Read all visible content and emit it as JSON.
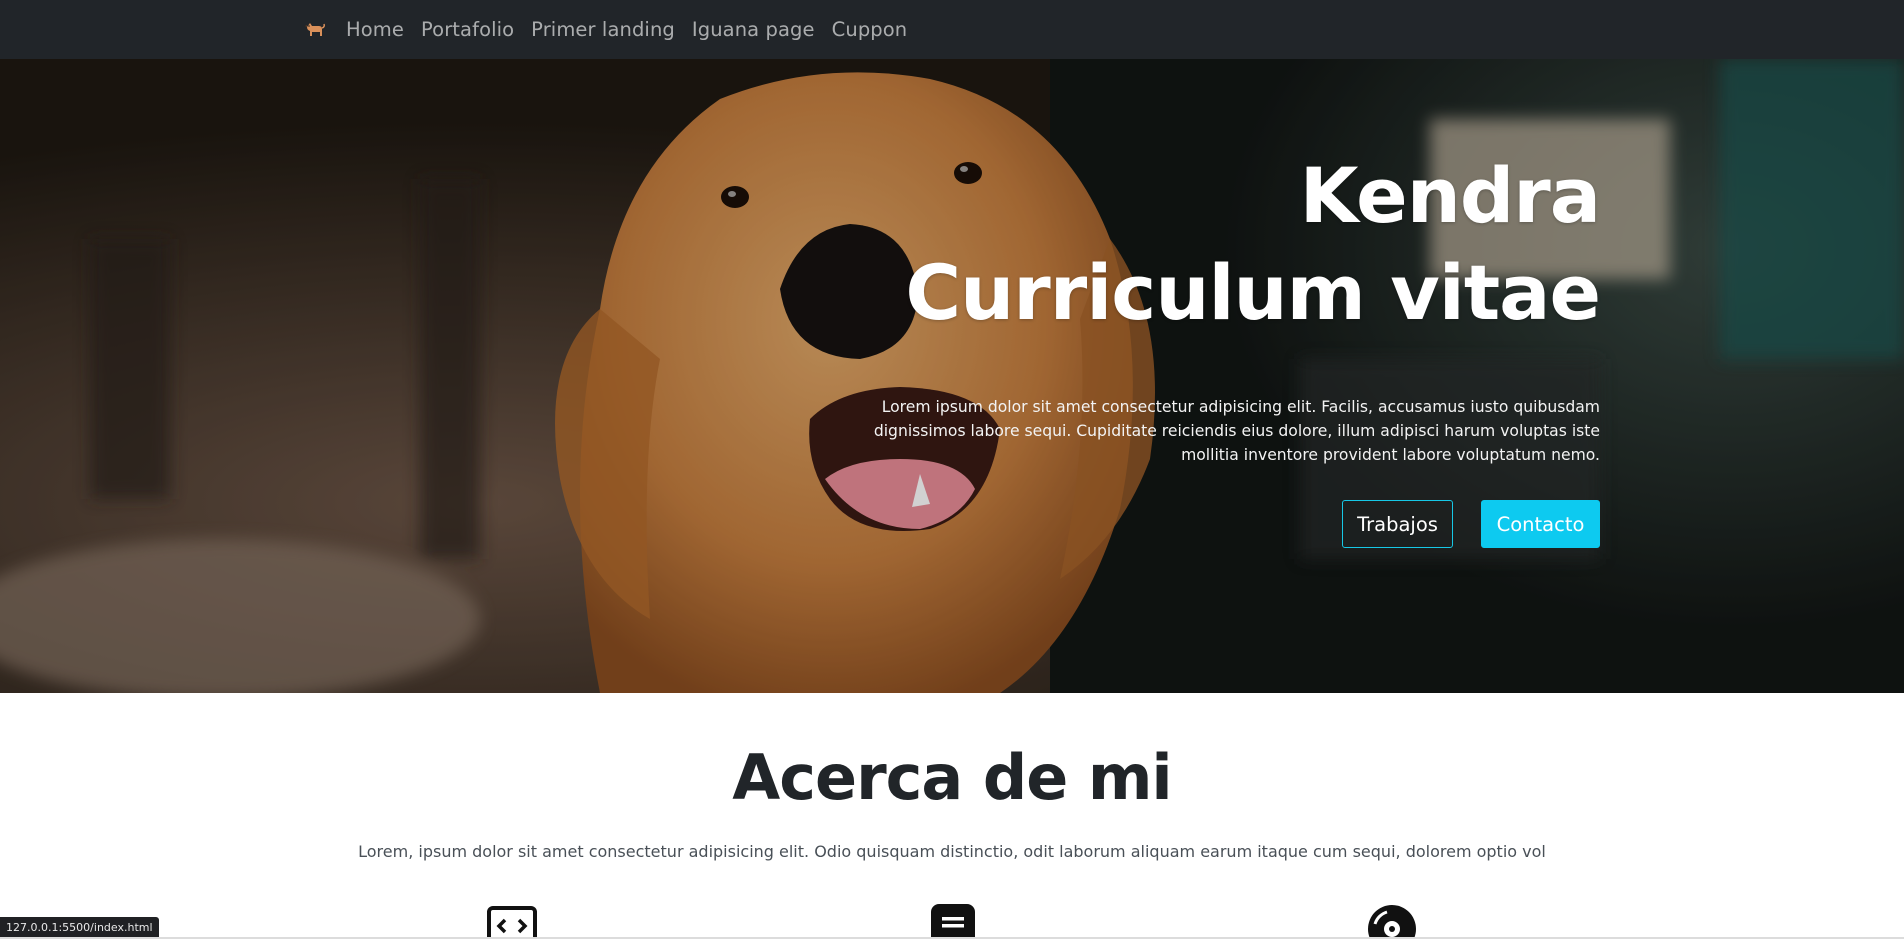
{
  "nav": {
    "brand_icon": "dog-icon",
    "links": [
      "Home",
      "Portafolio",
      "Primer landing",
      "Iguana page",
      "Cuppon"
    ]
  },
  "hero": {
    "title_line1": "Kendra",
    "title_line2": "Curriculum vitae",
    "description": "Lorem ipsum dolor sit amet consectetur adipisicing elit. Facilis, accusamus iusto quibusdam dignissimos labore sequi. Cupiditate reiciendis eius dolore, illum adipisci harum voluptas iste mollitia inventore provident labore voluptatum nemo.",
    "button_works": "Trabajos",
    "button_contact": "Contacto"
  },
  "about": {
    "title": "Acerca de mi",
    "text": "Lorem, ipsum dolor sit amet consectetur adipisicing elit. Odio quisquam distinctio, odit laborum aliquam earum itaque cum sequi, dolorem optio vol",
    "icons": [
      "code-icon",
      "chat-icon",
      "disc-icon"
    ]
  },
  "status_bar": {
    "url": "127.0.0.1:5500/index.html"
  },
  "colors": {
    "navbar": "#212529",
    "accent": "#0dcaf0"
  }
}
